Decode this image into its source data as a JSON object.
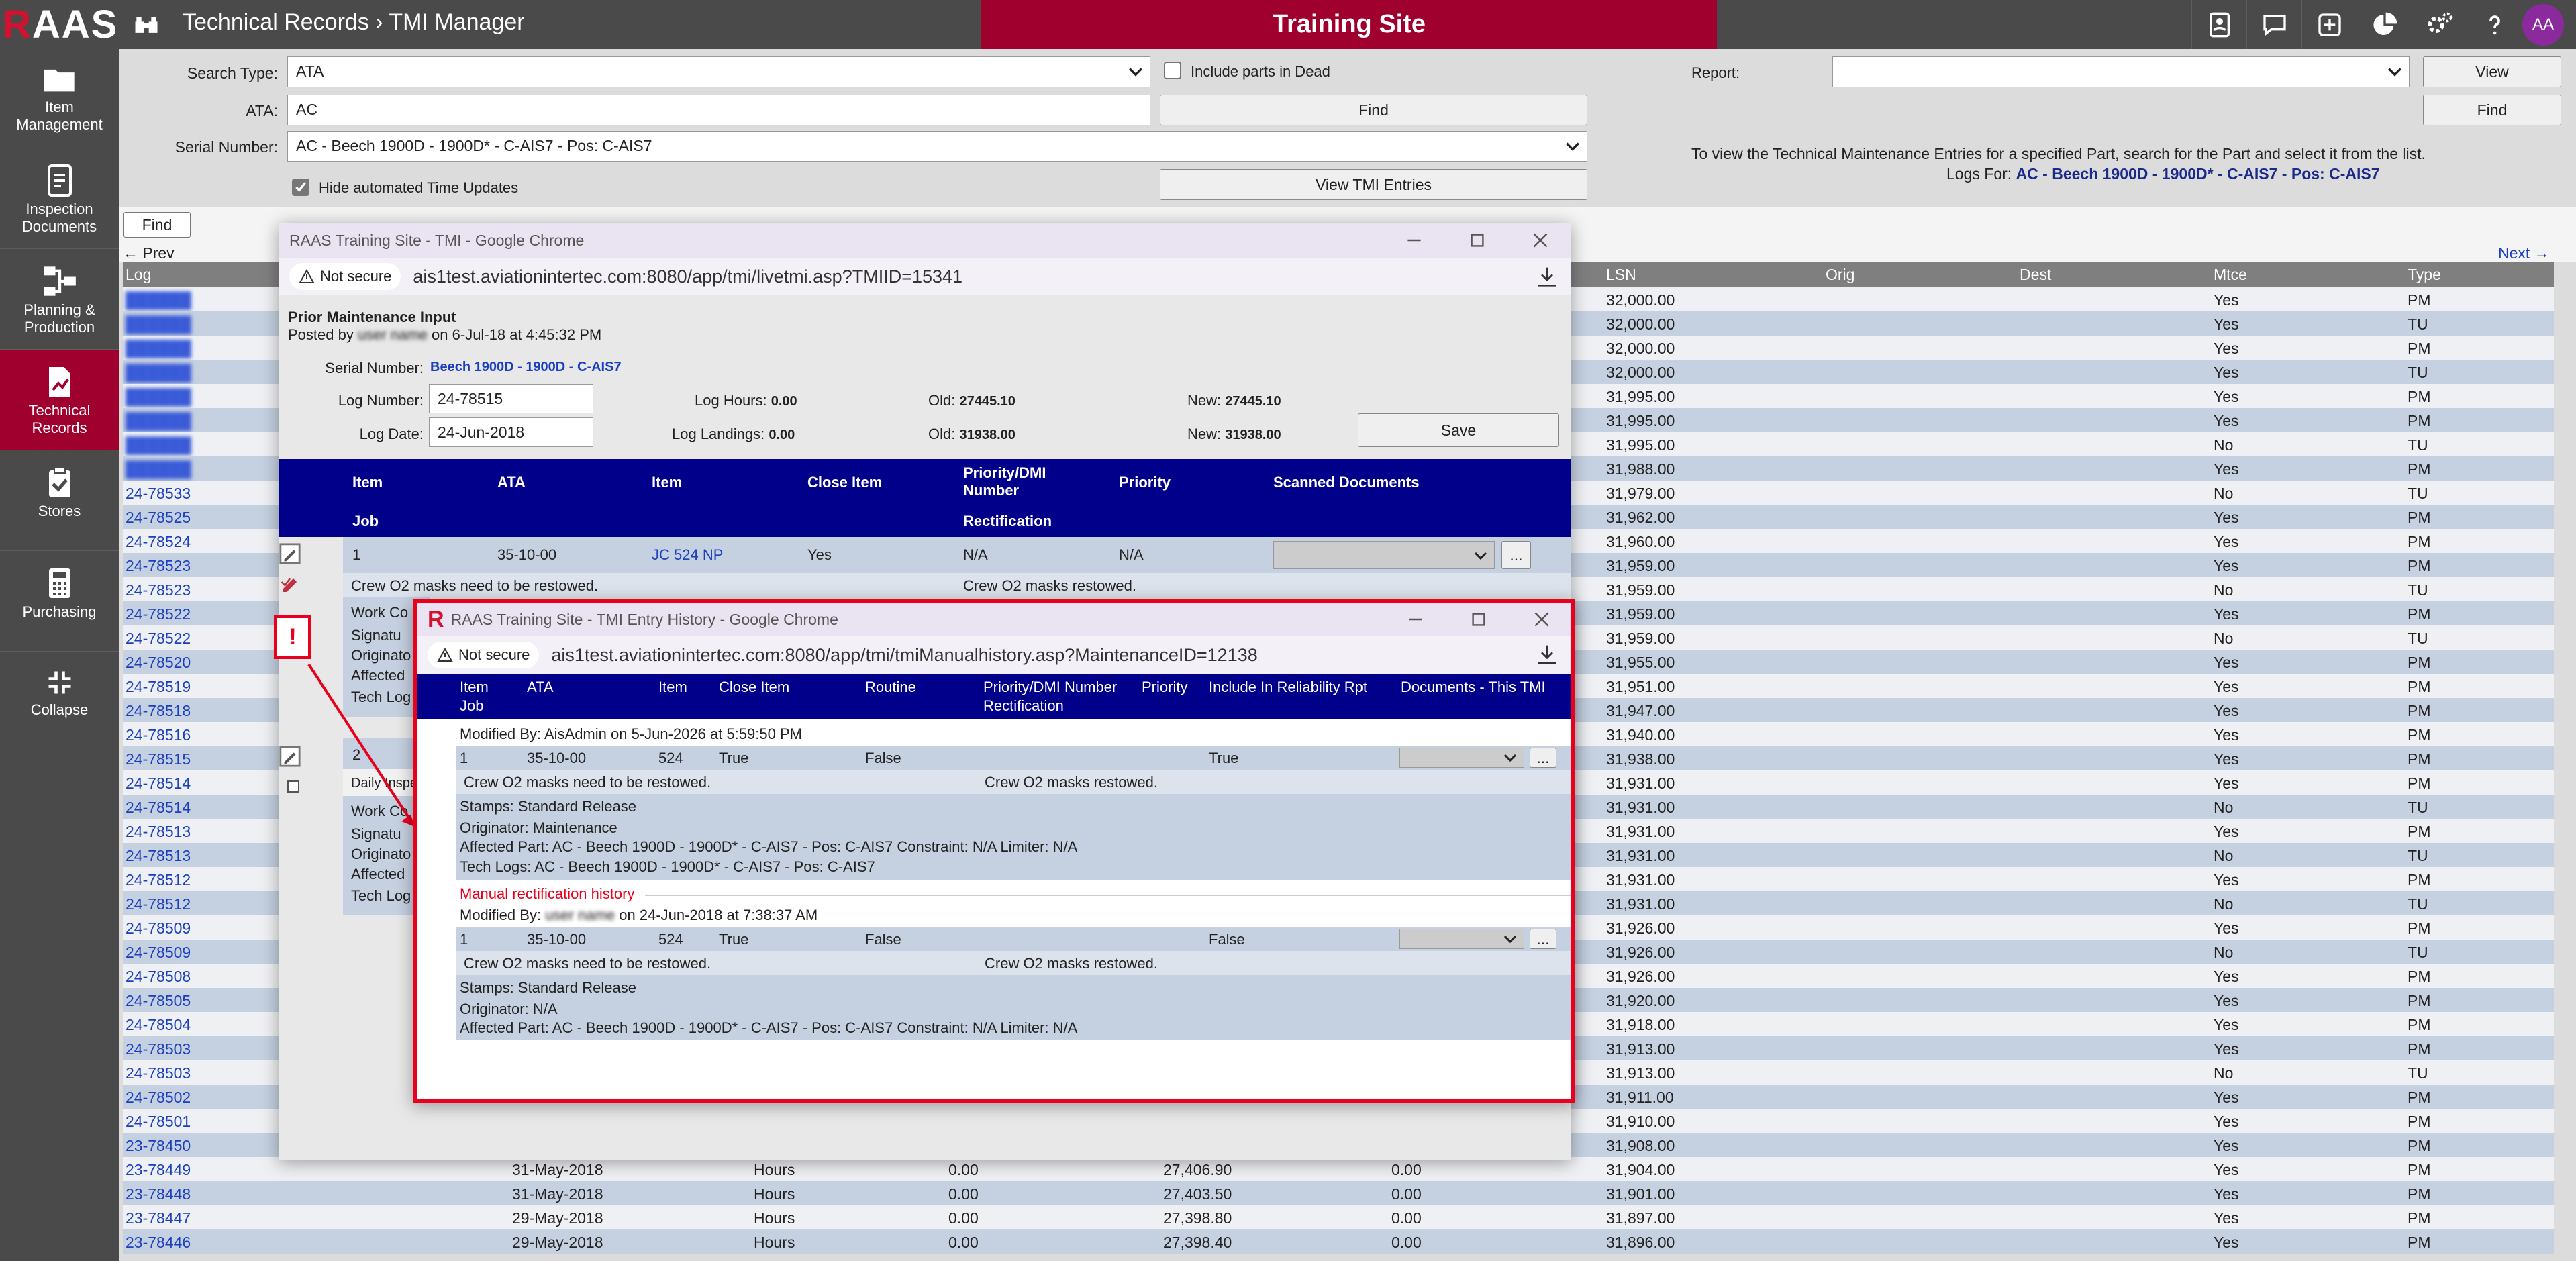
{
  "topbar": {
    "logo": "RAAS",
    "breadcrumb": "Technical Records › TMI Manager",
    "site": "Training Site",
    "avatar": "AA",
    "icons": [
      "contact-card-icon",
      "chat-icon",
      "plus-square-icon",
      "pie-chart-icon",
      "gears-icon",
      "help-icon"
    ]
  },
  "sidebar": [
    {
      "label": "Item Management",
      "icon": "folder-icon"
    },
    {
      "label": "Inspection Documents",
      "icon": "document-icon"
    },
    {
      "label": "Planning & Production",
      "icon": "workflow-icon"
    },
    {
      "label": "Technical Records",
      "icon": "chart-doc-icon",
      "active": true
    },
    {
      "label": "Stores",
      "icon": "clipboard-check-icon"
    },
    {
      "label": "Purchasing",
      "icon": "calculator-icon"
    },
    {
      "label": "Collapse",
      "icon": "collapse-arrows-icon"
    }
  ],
  "search": {
    "type_label": "Search Type:",
    "type_value": "ATA",
    "include_label": "Include parts in Dead",
    "ata_label": "ATA:",
    "ata_value": "AC",
    "find_label": "Find",
    "serial_label": "Serial Number:",
    "serial_value": "AC - Beech 1900D - 1900D* - C-AIS7 - Pos: C-AIS7",
    "hide_label": "Hide automated Time Updates",
    "view_tmi_label": "View TMI Entries",
    "report_label": "Report:",
    "view_label": "View",
    "find2_label": "Find",
    "hint": "To view the Technical Maintenance Entries for a specified Part, search for the Part and select it from the list."
  },
  "list": {
    "find_label": "Find",
    "logs_for_label": "Logs For:",
    "logs_for_value": "AC - Beech 1900D - 1900D* - C-AIS7 - Pos: C-AIS7",
    "prev": "← Prev",
    "next": "Next →",
    "headers": [
      "Log",
      "LSN",
      "Orig",
      "Dest",
      "Mtce",
      "Type"
    ],
    "rows": [
      [
        "",
        "32,000.00",
        "Yes",
        "PM"
      ],
      [
        "",
        "32,000.00",
        "Yes",
        "TU"
      ],
      [
        "",
        "32,000.00",
        "Yes",
        "PM"
      ],
      [
        "",
        "32,000.00",
        "Yes",
        "TU"
      ],
      [
        "",
        "31,995.00",
        "Yes",
        "PM"
      ],
      [
        "",
        "31,995.00",
        "Yes",
        "PM"
      ],
      [
        "",
        "31,995.00",
        "No",
        "TU"
      ],
      [
        "",
        "31,988.00",
        "Yes",
        "PM"
      ],
      [
        "24-78533",
        "31,979.00",
        "No",
        "TU"
      ],
      [
        "24-78525",
        "31,962.00",
        "Yes",
        "PM"
      ],
      [
        "24-78524",
        "31,960.00",
        "Yes",
        "PM"
      ],
      [
        "24-78523",
        "31,959.00",
        "Yes",
        "PM"
      ],
      [
        "24-78523",
        "31,959.00",
        "No",
        "TU"
      ],
      [
        "24-78522",
        "31,959.00",
        "Yes",
        "PM"
      ],
      [
        "24-78522",
        "31,959.00",
        "No",
        "TU"
      ],
      [
        "24-78520",
        "31,955.00",
        "Yes",
        "PM"
      ],
      [
        "24-78519",
        "31,951.00",
        "Yes",
        "PM"
      ],
      [
        "24-78518",
        "31,947.00",
        "Yes",
        "PM"
      ],
      [
        "24-78516",
        "31,940.00",
        "Yes",
        "PM"
      ],
      [
        "24-78515",
        "31,938.00",
        "Yes",
        "PM"
      ],
      [
        "24-78514",
        "31,931.00",
        "Yes",
        "PM"
      ],
      [
        "24-78514",
        "31,931.00",
        "No",
        "TU"
      ],
      [
        "24-78513",
        "31,931.00",
        "Yes",
        "PM"
      ],
      [
        "24-78513",
        "31,931.00",
        "No",
        "TU"
      ],
      [
        "24-78512",
        "31,931.00",
        "Yes",
        "PM"
      ],
      [
        "24-78512",
        "31,931.00",
        "No",
        "TU"
      ],
      [
        "24-78509",
        "31,926.00",
        "Yes",
        "PM"
      ],
      [
        "24-78509",
        "31,926.00",
        "No",
        "TU"
      ],
      [
        "24-78508",
        "31,926.00",
        "Yes",
        "PM"
      ],
      [
        "24-78505",
        "31,920.00",
        "Yes",
        "PM"
      ],
      [
        "24-78504",
        "31,918.00",
        "Yes",
        "PM"
      ],
      [
        "24-78503",
        "31,913.00",
        "Yes",
        "PM"
      ],
      [
        "24-78503",
        "31,913.00",
        "No",
        "TU"
      ],
      [
        "24-78502",
        "31,911.00",
        "Yes",
        "PM"
      ],
      [
        "24-78501",
        "31,910.00",
        "Yes",
        "PM"
      ],
      [
        "23-78450",
        "31,908.00",
        "Yes",
        "PM"
      ]
    ],
    "bottom_rows": [
      [
        "23-78449",
        "31-May-2018",
        "Hours",
        "0.00",
        "27,406.90",
        "0.00",
        "31,904.00",
        "Yes",
        "PM"
      ],
      [
        "23-78448",
        "31-May-2018",
        "Hours",
        "0.00",
        "27,403.50",
        "0.00",
        "31,901.00",
        "Yes",
        "PM"
      ],
      [
        "23-78447",
        "29-May-2018",
        "Hours",
        "0.00",
        "27,398.80",
        "0.00",
        "31,897.00",
        "Yes",
        "PM"
      ],
      [
        "23-78446",
        "29-May-2018",
        "Hours",
        "0.00",
        "27,398.40",
        "0.00",
        "31,896.00",
        "Yes",
        "PM"
      ]
    ]
  },
  "tmi": {
    "title": "RAAS Training Site - TMI - Google Chrome",
    "not_secure": "Not secure",
    "url": "ais1test.aviationintertec.com:8080/app/tmi/livetmi.asp?TMIID=15341",
    "heading": "Prior Maintenance Input",
    "posted_by": "Posted by",
    "posted_on": "on 6-Jul-18 at 4:45:32 PM",
    "serial_label": "Serial Number:",
    "serial_value": "Beech 1900D - 1900D - C-AIS7",
    "log_number_label": "Log Number:",
    "log_number": "24-78515",
    "log_date_label": "Log Date:",
    "log_date": "24-Jun-2018",
    "log_hours_label": "Log Hours:",
    "log_hours": "0.00",
    "log_landings_label": "Log Landings:",
    "log_landings": "0.00",
    "old_label": "Old:",
    "old_hours": "27445.10",
    "old_landings": "31938.00",
    "new_label": "New:",
    "new_hours": "27445.10",
    "new_landings": "31938.00",
    "save": "Save",
    "hdr": {
      "item": "Item",
      "ata": "ATA",
      "item2": "Item",
      "close": "Close Item",
      "prio": "Priority/DMI Number",
      "priority": "Priority",
      "scanned": "Scanned Documents",
      "job": "Job",
      "rect": "Rectification"
    },
    "row1": {
      "item": "1",
      "ata": "35-10-00",
      "item2": "JC 524 NP",
      "close": "Yes",
      "prio": "N/A",
      "priority": "N/A",
      "more": "..."
    },
    "job1": "Crew O2 masks need to be restowed.",
    "rect1": "Crew O2 masks restowed.",
    "detail_labels": [
      "Work Co",
      "Signatu",
      "Originato",
      "Affected",
      "Tech Log"
    ],
    "row2_item": "2",
    "row2_job": "Daily Inspe",
    "detail2_labels": [
      "Work Co",
      "Signatu",
      "Originato",
      "Affected",
      "Tech Log"
    ]
  },
  "history": {
    "title": "RAAS Training Site - TMI Entry History - Google Chrome",
    "not_secure": "Not secure",
    "url": "ais1test.aviationintertec.com:8080/app/tmi/tmiManualhistory.asp?MaintenanceID=12138",
    "hdr": {
      "item": "Item",
      "job": "Job",
      "ata": "ATA",
      "item2": "Item",
      "close": "Close Item",
      "routine": "Routine",
      "prio": "Priority/DMI Number",
      "rect": "Rectification",
      "priority": "Priority",
      "rel": "Include In Reliability Rpt",
      "docs": "Documents - This TMI"
    },
    "mod1": "Modified By: AisAdmin on 5-Jun-2026 at 5:59:50 PM",
    "row1": {
      "item": "1",
      "ata": "35-10-00",
      "item2": "524",
      "close": "True",
      "routine": "False",
      "rel": "True",
      "more": "..."
    },
    "job": "Crew O2 masks need to be restowed.",
    "rect": "Crew O2 masks restowed.",
    "stamps": "Stamps: Standard Release",
    "orig1": "Originator: Maintenance",
    "affected": "Affected Part: AC - Beech 1900D - 1900D* - C-AIS7 - Pos: C-AIS7 Constraint: N/A Limiter: N/A",
    "tech": "Tech Logs: AC - Beech 1900D - 1900D* - C-AIS7 - Pos: C-AIS7",
    "manual": "Manual rectification history",
    "mod2_pre": "Modified By:",
    "mod2_post": "on 24-Jun-2018 at 7:38:37 AM",
    "row2": {
      "item": "1",
      "ata": "35-10-00",
      "item2": "524",
      "close": "True",
      "routine": "False",
      "rel": "False",
      "more": "..."
    },
    "orig2": "Originator: N/A"
  },
  "colors": {
    "brand": "#a0002e",
    "navy": "#00008b",
    "link": "#1a3fbf",
    "highlight": "#e8001c"
  }
}
